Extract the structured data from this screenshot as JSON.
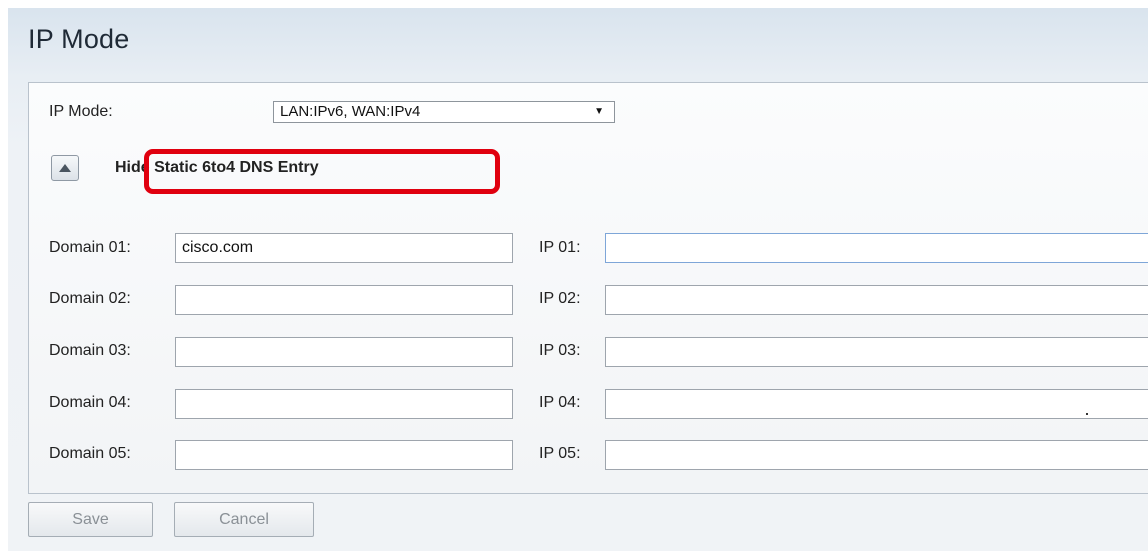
{
  "page": {
    "title": "IP Mode"
  },
  "ip_mode": {
    "label": "IP Mode:",
    "selected_value": "LAN:IPv6, WAN:IPv4",
    "dropdown_icon": "triangle-down-icon"
  },
  "dns_section": {
    "toggle_icon": "triangle-up-icon",
    "toggle_label": "Hide Static 6to4 DNS Entry"
  },
  "entries": [
    {
      "domain_label": "Domain 01:",
      "domain_value": "cisco.com",
      "ip_label": "IP 01:",
      "ip_value": "",
      "highlighted": true,
      "ip_focused": true
    },
    {
      "domain_label": "Domain 02:",
      "domain_value": "",
      "ip_label": "IP 02:",
      "ip_value": ""
    },
    {
      "domain_label": "Domain 03:",
      "domain_value": "",
      "ip_label": "IP 03:",
      "ip_value": ""
    },
    {
      "domain_label": "Domain 04:",
      "domain_value": "",
      "ip_label": "IP 04:",
      "ip_value": ""
    },
    {
      "domain_label": "Domain 05:",
      "domain_value": "",
      "ip_label": "IP 05:",
      "ip_value": ""
    }
  ],
  "buttons": {
    "save_label": "Save",
    "cancel_label": "Cancel"
  },
  "colors": {
    "highlight": "#e0000f",
    "header_background": "#d9e4ee",
    "focused_border": "#7ea6d8"
  }
}
